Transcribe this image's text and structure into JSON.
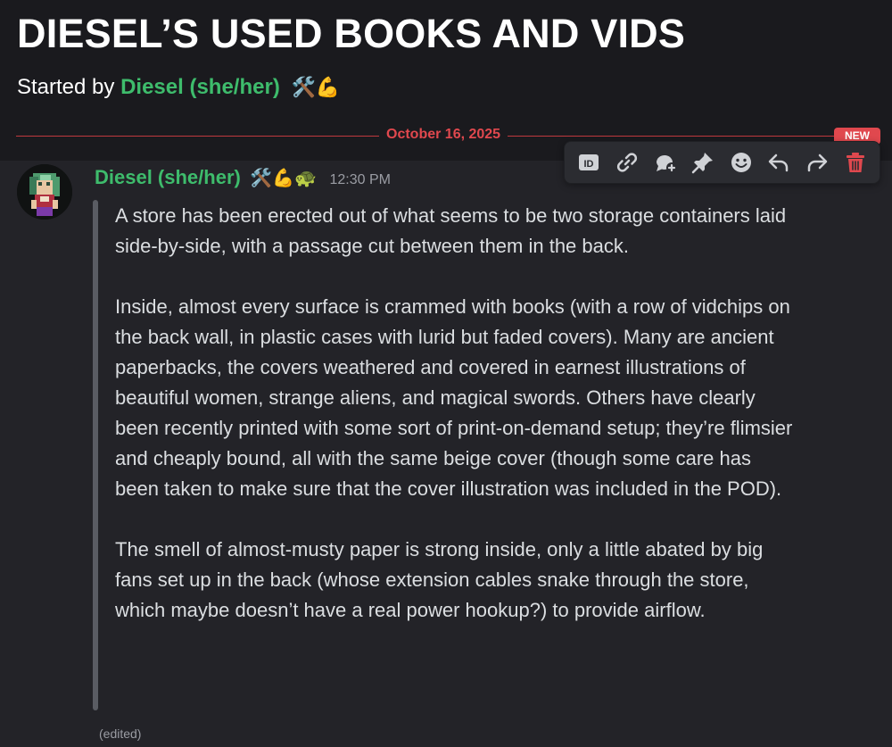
{
  "thread": {
    "title": "DIESEL’S USED BOOKS AND VIDS",
    "started_by_prefix": "Started by",
    "author": "Diesel (she/her)",
    "author_emojis": "🛠️💪"
  },
  "divider": {
    "date": "October 16, 2025",
    "new_label": "NEW"
  },
  "toolbar": {
    "icons": [
      "id-icon",
      "link-icon",
      "thread-reply-icon",
      "pin-icon",
      "emoji-icon",
      "reply-icon",
      "forward-icon",
      "trash-icon"
    ],
    "danger_color": "#e0484e"
  },
  "message": {
    "author": "Diesel  (she/her)",
    "author_emojis": "🛠️💪🐢",
    "author_color": "#3ebc6c",
    "time": "12:30 PM",
    "paragraphs": [
      "A store has been erected out of what seems to be two storage containers laid side-by-side, with a passage cut between them in the back.",
      "Inside, almost every surface is crammed with books (with a row of vidchips on the back wall, in plastic cases with lurid but faded covers). Many are ancient paperbacks, the covers weathered and covered in earnest illustrations of beautiful women, strange aliens, and magical swords. Others have clearly been recently printed with some sort of print-on-demand setup; they’re flimsier and cheaply bound, all with the same beige cover (though some care has been taken to make sure that the cover illustration was included in the POD).",
      "The smell of almost-musty paper  is strong inside, only a little abated by big fans set up in the back (whose extension cables snake through the store, which maybe doesn’t have a real power hookup?) to provide airflow."
    ],
    "edited_label": "(edited)"
  }
}
